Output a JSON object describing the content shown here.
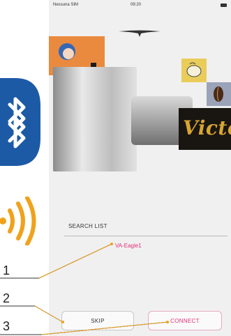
{
  "status_bar": {
    "carrier": "Nessuna SIM",
    "time": "09:20"
  },
  "search": {
    "title": "SEARCH LIST",
    "device": "VA-Eagle1"
  },
  "buttons": {
    "skip": "SKIP",
    "connect": "CONNECT"
  },
  "callouts": [
    "1",
    "2",
    "3"
  ],
  "brand_text": "Victor",
  "icons": {
    "bluetooth": "bluetooth-icon",
    "nfc": "nfc-signal-icon",
    "wifi": "wifi-icon",
    "battery": "battery-icon",
    "logo": "wing-logo-icon"
  },
  "colors": {
    "accent": "#e0307a",
    "bluetooth": "#1d5aa6",
    "nfc": "#f0a21c",
    "callout_line": "#f0a21c"
  }
}
